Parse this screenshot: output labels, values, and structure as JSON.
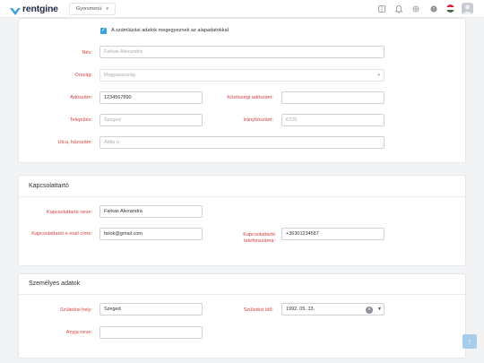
{
  "topbar": {
    "logo_text": "rentgine",
    "quick_menu_label": "Gyorsmenü",
    "icons": [
      "grid-icon",
      "bell-icon",
      "gear-icon",
      "help-icon"
    ],
    "flag": "hungarian-flag",
    "colors": {
      "accent": "#3aa2d9",
      "logo": "#1f2a44"
    }
  },
  "billing": {
    "same_as_base_label": "A számlázási adatok megegyeznek az alapadatokkal",
    "same_as_base_checked": true,
    "fields": {
      "name": {
        "label": "Név:",
        "placeholder": "Farkas Alexandra",
        "value": ""
      },
      "country": {
        "label": "Ország:",
        "placeholder": "Magyarország",
        "value": ""
      },
      "tax_number": {
        "label": "Adószám:",
        "value": "1234567890"
      },
      "community_tax_number": {
        "label": "Közösségi adószám:",
        "value": ""
      },
      "city": {
        "label": "Település:",
        "placeholder": "Szeged",
        "value": ""
      },
      "postal_code": {
        "label": "Irányítószám:",
        "placeholder": "6725",
        "value": ""
      },
      "street": {
        "label": "Utca, házszám:",
        "placeholder": "Attila u.",
        "value": ""
      }
    }
  },
  "contact": {
    "title": "Kapcsolattartó",
    "fields": {
      "name": {
        "label": "Kapcsolattartó neve:",
        "value": "Farkas Alexandra"
      },
      "email": {
        "label": "Kapcsolattartó e-mail címe:",
        "value": "farok@gmail.com"
      },
      "phone": {
        "label": "Kapcsolattartó telefonszáma:",
        "value": "+36301234567"
      }
    }
  },
  "personal": {
    "title": "Személyes adatok",
    "fields": {
      "birth_place": {
        "label": "Születési hely:",
        "value": "Szeged"
      },
      "birth_date": {
        "label": "Születési idő:",
        "value": "1992. 05. 13."
      },
      "mother_name": {
        "label": "Anyja neve:",
        "value": ""
      }
    }
  }
}
